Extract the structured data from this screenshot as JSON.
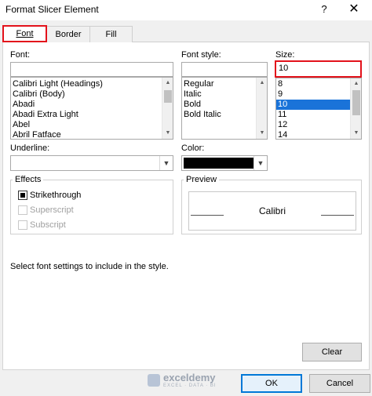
{
  "window": {
    "title": "Format Slicer Element",
    "help": "?",
    "close": "✕"
  },
  "tabs": [
    {
      "label": "Font"
    },
    {
      "label": "Border"
    },
    {
      "label": "Fill"
    }
  ],
  "font": {
    "label": "Font:",
    "value": "",
    "items": [
      "Calibri Light (Headings)",
      "Calibri (Body)",
      "Abadi",
      "Abadi Extra Light",
      "Abel",
      "Abril Fatface"
    ]
  },
  "font_style": {
    "label": "Font style:",
    "value": "",
    "items": [
      "Regular",
      "Italic",
      "Bold",
      "Bold Italic"
    ]
  },
  "size": {
    "label": "Size:",
    "value": "10",
    "items": [
      "8",
      "9",
      "10",
      "11",
      "12",
      "14"
    ],
    "selected": "10"
  },
  "underline": {
    "label": "Underline:",
    "value": ""
  },
  "color": {
    "label": "Color:",
    "value_color": "#000000"
  },
  "effects": {
    "title": "Effects",
    "strikethrough": {
      "label": "Strikethrough",
      "checked": true
    },
    "superscript": {
      "label": "Superscript",
      "checked": false
    },
    "subscript": {
      "label": "Subscript",
      "checked": false
    }
  },
  "preview": {
    "title": "Preview",
    "sample": "Calibri"
  },
  "hint": "Select font settings to include in the style.",
  "buttons": {
    "clear": "Clear",
    "ok": "OK",
    "cancel": "Cancel"
  },
  "watermark": {
    "name": "exceldemy",
    "tagline": "EXCEL · DATA · BI"
  },
  "colors": {
    "highlight": "#e3121b",
    "selection": "#1a73d9",
    "accent": "#0078d7"
  }
}
